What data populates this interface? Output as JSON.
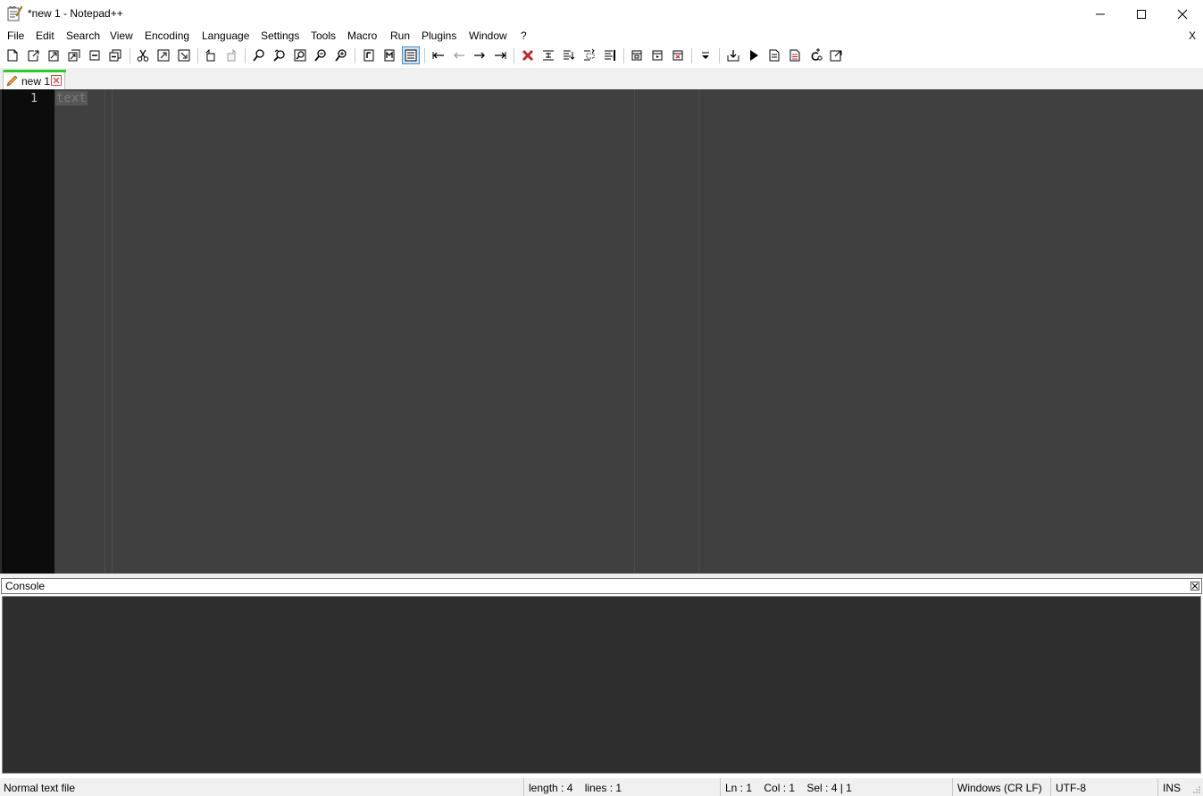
{
  "window": {
    "title": "*new 1 - Notepad++"
  },
  "menu": {
    "items": [
      "File",
      "Edit",
      "Search",
      "View",
      "Encoding",
      "Language",
      "Settings",
      "Tools",
      "Macro",
      "Run",
      "Plugins",
      "Window",
      "?"
    ],
    "close_label": "X"
  },
  "tabs": [
    {
      "label": "new 1",
      "modified": true
    }
  ],
  "editor": {
    "line_numbers": [
      "1"
    ],
    "lines": [
      "text"
    ]
  },
  "console": {
    "title": "Console"
  },
  "status": {
    "file_type": "Normal text file",
    "length_lines": "length : 4    lines : 1",
    "position": "Ln : 1    Col : 1    Sel : 4 | 1",
    "eol": "Windows (CR LF)",
    "encoding": "UTF-8",
    "mode": "INS"
  },
  "colors": {
    "editor_bg": "#404040",
    "gutter_bg": "#0c0c0c",
    "console_bg": "#2e2e2e",
    "tab_accent": "#21d321",
    "stop_red": "#c0282d"
  },
  "toolbar_icons": [
    "new-file-icon",
    "open-file-icon",
    "save-icon",
    "save-all-icon",
    "close-icon",
    "close-all-icon",
    "cut-icon",
    "copy-icon",
    "paste-icon",
    "undo-icon",
    "redo-icon",
    "find-icon",
    "replace-icon",
    "find-in-files-icon",
    "zoom-out-icon",
    "zoom-in-icon",
    "sync-vertical-icon",
    "sync-horizontal-icon",
    "word-wrap-icon",
    "nav-back-icon",
    "nav-back-disabled-icon",
    "nav-forward-icon",
    "nav-forward-end-icon",
    "stop-recording-icon",
    "indent-guide-icon",
    "fold-all-icon",
    "unfold-all-icon",
    "doc-map-icon",
    "panel-icon",
    "function-list-icon",
    "folder-workspace-icon",
    "dropdown-icon",
    "macro-record-icon",
    "macro-play-icon",
    "macro-save-icon",
    "macro-run-icon",
    "plugin-icon",
    "launch-icon"
  ]
}
